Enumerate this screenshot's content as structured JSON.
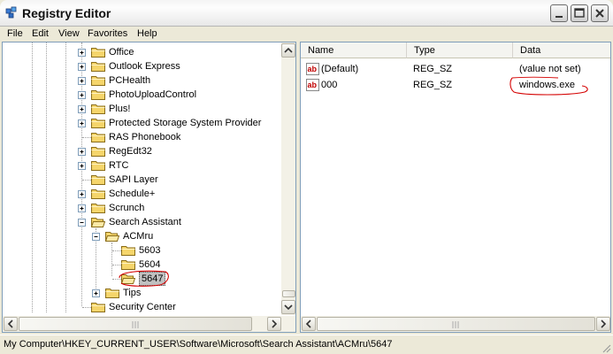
{
  "window": {
    "title": "Registry Editor"
  },
  "menu": [
    "File",
    "Edit",
    "View",
    "Favorites",
    "Help"
  ],
  "tree": {
    "items": [
      {
        "label": "Office",
        "expandable": true,
        "level": 0
      },
      {
        "label": "Outlook Express",
        "expandable": true,
        "level": 0
      },
      {
        "label": "PCHealth",
        "expandable": true,
        "level": 0
      },
      {
        "label": "PhotoUploadControl",
        "expandable": true,
        "level": 0
      },
      {
        "label": "Plus!",
        "expandable": true,
        "level": 0
      },
      {
        "label": "Protected Storage System Provider",
        "expandable": true,
        "level": 0
      },
      {
        "label": "RAS Phonebook",
        "expandable": false,
        "level": 0
      },
      {
        "label": "RegEdt32",
        "expandable": true,
        "level": 0
      },
      {
        "label": "RTC",
        "expandable": true,
        "level": 0
      },
      {
        "label": "SAPI Layer",
        "expandable": false,
        "level": 0
      },
      {
        "label": "Schedule+",
        "expandable": true,
        "level": 0
      },
      {
        "label": "Scrunch",
        "expandable": true,
        "level": 0
      },
      {
        "label": "Search Assistant",
        "expandable": true,
        "expanded": true,
        "level": 0
      },
      {
        "label": "ACMru",
        "expandable": true,
        "expanded": true,
        "level": 1
      },
      {
        "label": "5603",
        "expandable": false,
        "level": 2
      },
      {
        "label": "5604",
        "expandable": false,
        "level": 2
      },
      {
        "label": "5647",
        "expandable": false,
        "level": 2,
        "selected": true
      },
      {
        "label": "Tips",
        "expandable": true,
        "level": 1
      },
      {
        "label": "Security Center",
        "expandable": false,
        "level": 0
      }
    ]
  },
  "values": {
    "columns": [
      "Name",
      "Type",
      "Data"
    ],
    "rows": [
      {
        "name": "(Default)",
        "type": "REG_SZ",
        "data": "(value not set)"
      },
      {
        "name": "000",
        "type": "REG_SZ",
        "data": "windows.exe"
      }
    ]
  },
  "status": {
    "path": "My Computer\\HKEY_CURRENT_USER\\Software\\Microsoft\\Search Assistant\\ACMru\\5647"
  },
  "colors": {
    "annotation": "#d40000",
    "folder": "#f5d56b",
    "selection": "#c0c0c0"
  }
}
